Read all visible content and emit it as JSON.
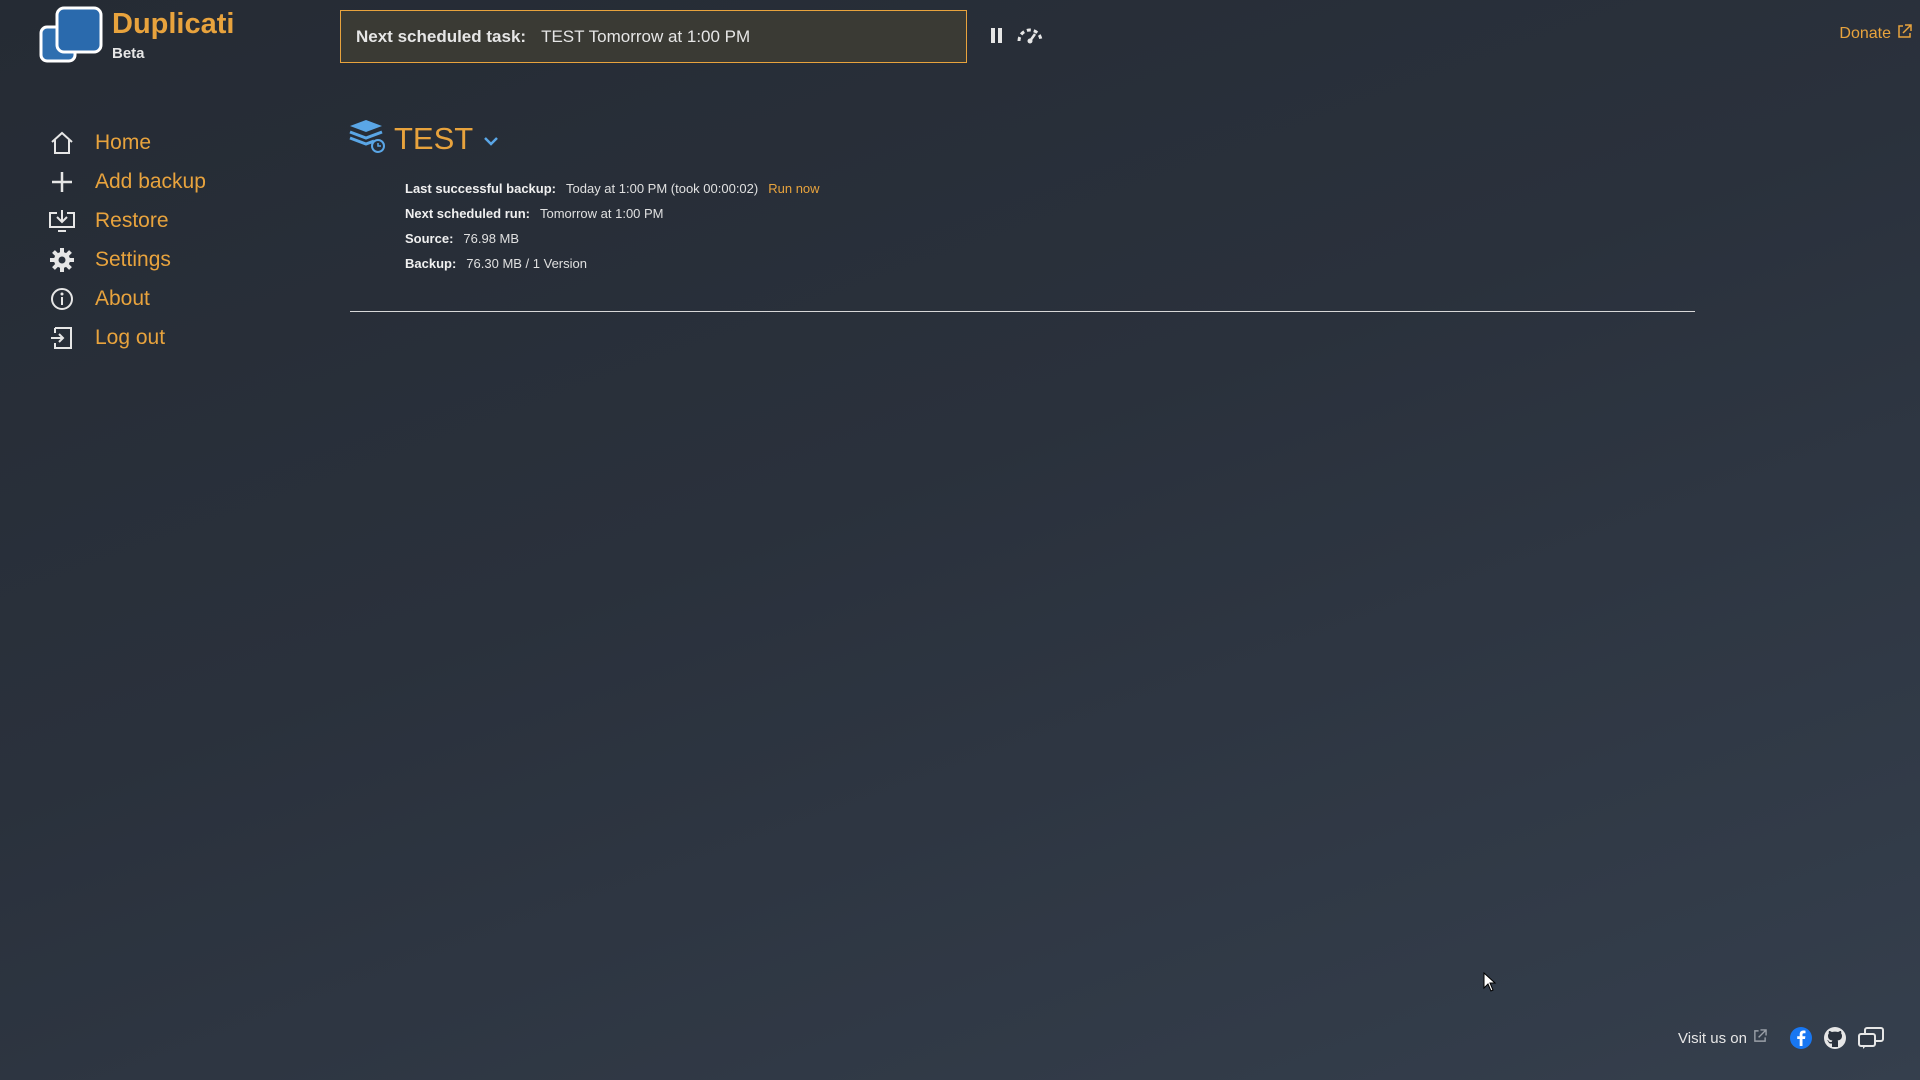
{
  "app": {
    "name": "Duplicati",
    "edition": "Beta",
    "accent": "#e8a33d"
  },
  "status": {
    "label": "Next scheduled task:",
    "value": "TEST Tomorrow at 1:00 PM"
  },
  "controls": {
    "pause_icon": "pause-icon",
    "throttle_icon": "speed-gauge-icon"
  },
  "donate": {
    "label": "Donate"
  },
  "sidebar": {
    "items": [
      {
        "label": "Home",
        "icon": "home-icon"
      },
      {
        "label": "Add backup",
        "icon": "plus-icon"
      },
      {
        "label": "Restore",
        "icon": "restore-icon"
      },
      {
        "label": "Settings",
        "icon": "gear-icon"
      },
      {
        "label": "About",
        "icon": "info-icon"
      },
      {
        "label": "Log out",
        "icon": "logout-icon"
      }
    ]
  },
  "backup": {
    "name": "TEST",
    "last_label": "Last successful backup:",
    "last_value": "Today at 1:00 PM (took 00:00:02)",
    "run_now": "Run now",
    "next_label": "Next scheduled run:",
    "next_value": "Tomorrow at 1:00 PM",
    "source_label": "Source:",
    "source_value": "76.98 MB",
    "backup_label": "Backup:",
    "backup_value": "76.30 MB / 1 Version"
  },
  "footer": {
    "visit_label": "Visit us on",
    "icons": [
      "facebook-icon",
      "github-icon",
      "forum-icon"
    ]
  }
}
